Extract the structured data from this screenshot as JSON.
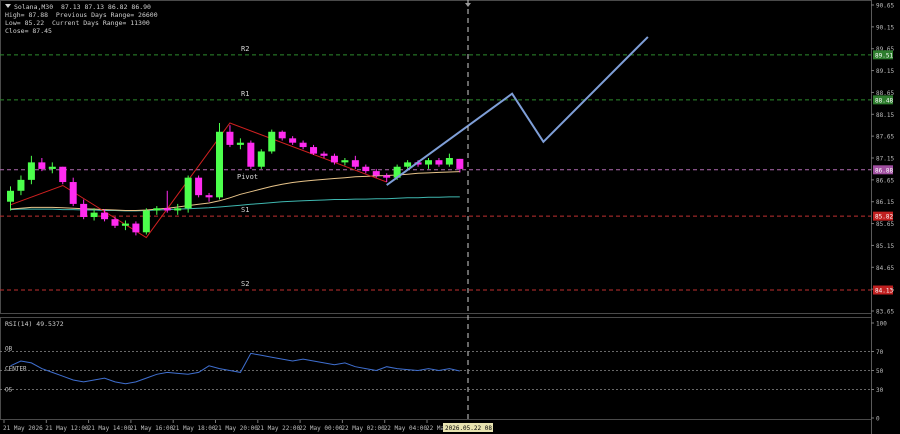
{
  "header": {
    "symbol_line": "Solana,M30  87.13 87.13 86.82 86.90",
    "lines": [
      "High= 87.88  Previous Days Range= 26600",
      "Low= 85.22  Current Days Range= 11300",
      "Close= 87.45"
    ]
  },
  "colors": {
    "bull": "#4cff4c",
    "bear": "#ff2bf0",
    "r_line": "#2e8b2e",
    "s_line": "#c03030",
    "pivot_line": "#b06ab0",
    "ma_fast": "#e8c48a",
    "ma_slow": "#3fb8b0",
    "forecast": "#7f9fd8",
    "zigzag": "#d02020",
    "rsi": "#3f6fd0",
    "r_tag": "#2e7d2e",
    "s_tag": "#c02020",
    "pivot_tag": "#a04fa0"
  },
  "chart_data": {
    "type": "candlestick",
    "price_axis": {
      "min": 83.65,
      "max": 90.65,
      "ticks": [
        "90.65",
        "90.15",
        "89.65",
        "89.15",
        "88.65",
        "88.15",
        "87.65",
        "87.15",
        "86.65",
        "86.15",
        "85.65",
        "85.15",
        "84.65",
        "84.15",
        "83.65"
      ]
    },
    "time_labels": [
      "21 May 2026",
      "21 May 12:00",
      "21 May 14:00",
      "21 May 16:00",
      "21 May 18:00",
      "21 May 20:00",
      "21 May 22:00",
      "22 May 00:00",
      "22 May 02:00",
      "22 May 04:00",
      "22 May 06:00"
    ],
    "cursor_time": "2026.05.22 08:00",
    "levels": [
      {
        "name": "R2",
        "value": 89.51,
        "tag": "89.51",
        "kind": "r"
      },
      {
        "name": "R1",
        "value": 88.48,
        "tag": "88.48",
        "kind": "r"
      },
      {
        "name": "Pivot",
        "value": 86.88,
        "tag": "86.88",
        "kind": "p"
      },
      {
        "name": "S1",
        "value": 85.82,
        "tag": "85.82",
        "kind": "s"
      },
      {
        "name": "S2",
        "value": 84.13,
        "tag": "84.13",
        "kind": "s"
      }
    ],
    "candles": [
      {
        "o": 86.15,
        "h": 86.5,
        "l": 85.95,
        "c": 86.4
      },
      {
        "o": 86.4,
        "h": 86.75,
        "l": 86.3,
        "c": 86.65
      },
      {
        "o": 86.65,
        "h": 87.2,
        "l": 86.55,
        "c": 87.05
      },
      {
        "o": 87.05,
        "h": 87.15,
        "l": 86.85,
        "c": 86.9
      },
      {
        "o": 86.9,
        "h": 87.05,
        "l": 86.8,
        "c": 86.95
      },
      {
        "o": 86.95,
        "h": 86.95,
        "l": 86.55,
        "c": 86.6
      },
      {
        "o": 86.6,
        "h": 86.7,
        "l": 86.05,
        "c": 86.1
      },
      {
        "o": 86.1,
        "h": 86.2,
        "l": 85.75,
        "c": 85.8
      },
      {
        "o": 85.8,
        "h": 86.0,
        "l": 85.72,
        "c": 85.9
      },
      {
        "o": 85.9,
        "h": 85.98,
        "l": 85.7,
        "c": 85.75
      },
      {
        "o": 85.75,
        "h": 85.8,
        "l": 85.55,
        "c": 85.6
      },
      {
        "o": 85.6,
        "h": 85.72,
        "l": 85.5,
        "c": 85.65
      },
      {
        "o": 85.65,
        "h": 85.7,
        "l": 85.38,
        "c": 85.45
      },
      {
        "o": 85.45,
        "h": 86.0,
        "l": 85.4,
        "c": 85.95
      },
      {
        "o": 85.95,
        "h": 86.05,
        "l": 85.85,
        "c": 86.0
      },
      {
        "o": 86.0,
        "h": 86.4,
        "l": 85.9,
        "c": 85.95
      },
      {
        "o": 85.95,
        "h": 86.1,
        "l": 85.85,
        "c": 86.0
      },
      {
        "o": 86.0,
        "h": 86.75,
        "l": 85.9,
        "c": 86.7
      },
      {
        "o": 86.7,
        "h": 86.75,
        "l": 86.25,
        "c": 86.3
      },
      {
        "o": 86.3,
        "h": 86.35,
        "l": 86.15,
        "c": 86.25
      },
      {
        "o": 86.25,
        "h": 87.95,
        "l": 86.2,
        "c": 87.75
      },
      {
        "o": 87.75,
        "h": 87.9,
        "l": 87.4,
        "c": 87.45
      },
      {
        "o": 87.45,
        "h": 87.6,
        "l": 87.35,
        "c": 87.5
      },
      {
        "o": 87.5,
        "h": 87.55,
        "l": 86.9,
        "c": 86.95
      },
      {
        "o": 86.95,
        "h": 87.35,
        "l": 86.9,
        "c": 87.3
      },
      {
        "o": 87.3,
        "h": 87.8,
        "l": 87.25,
        "c": 87.75
      },
      {
        "o": 87.75,
        "h": 87.78,
        "l": 87.55,
        "c": 87.6
      },
      {
        "o": 87.6,
        "h": 87.65,
        "l": 87.45,
        "c": 87.5
      },
      {
        "o": 87.5,
        "h": 87.55,
        "l": 87.35,
        "c": 87.4
      },
      {
        "o": 87.4,
        "h": 87.45,
        "l": 87.22,
        "c": 87.25
      },
      {
        "o": 87.25,
        "h": 87.3,
        "l": 87.15,
        "c": 87.2
      },
      {
        "o": 87.2,
        "h": 87.25,
        "l": 87.0,
        "c": 87.05
      },
      {
        "o": 87.05,
        "h": 87.15,
        "l": 86.98,
        "c": 87.1
      },
      {
        "o": 87.1,
        "h": 87.2,
        "l": 86.9,
        "c": 86.95
      },
      {
        "o": 86.95,
        "h": 87.0,
        "l": 86.8,
        "c": 86.85
      },
      {
        "o": 86.85,
        "h": 86.9,
        "l": 86.7,
        "c": 86.75
      },
      {
        "o": 86.75,
        "h": 86.8,
        "l": 86.6,
        "c": 86.7
      },
      {
        "o": 86.7,
        "h": 87.0,
        "l": 86.65,
        "c": 86.95
      },
      {
        "o": 86.95,
        "h": 87.1,
        "l": 86.9,
        "c": 87.05
      },
      {
        "o": 87.05,
        "h": 87.1,
        "l": 86.95,
        "c": 87.0
      },
      {
        "o": 87.0,
        "h": 87.15,
        "l": 86.9,
        "c": 87.1
      },
      {
        "o": 87.1,
        "h": 87.15,
        "l": 86.95,
        "c": 87.0
      },
      {
        "o": 87.0,
        "h": 87.25,
        "l": 86.95,
        "c": 87.15
      },
      {
        "o": 87.13,
        "h": 87.13,
        "l": 86.82,
        "c": 86.9
      }
    ],
    "ma_fast": [
      85.98,
      86.0,
      86.02,
      86.02,
      86.02,
      86.01,
      86.0,
      85.99,
      85.98,
      85.97,
      85.96,
      85.95,
      85.95,
      85.96,
      85.98,
      86.0,
      86.03,
      86.06,
      86.09,
      86.12,
      86.17,
      86.24,
      86.32,
      86.38,
      86.44,
      86.5,
      86.55,
      86.59,
      86.62,
      86.64,
      86.66,
      86.68,
      86.7,
      86.72,
      86.73,
      86.74,
      86.75,
      86.76,
      86.78,
      86.8,
      86.81,
      86.82,
      86.83,
      86.84
    ],
    "ma_slow": [
      85.97,
      85.98,
      85.98,
      85.98,
      85.98,
      85.97,
      85.97,
      85.96,
      85.96,
      85.95,
      85.95,
      85.94,
      85.94,
      85.95,
      85.96,
      85.97,
      85.98,
      85.99,
      86.0,
      86.01,
      86.03,
      86.05,
      86.07,
      86.09,
      86.11,
      86.13,
      86.15,
      86.16,
      86.17,
      86.18,
      86.19,
      86.2,
      86.2,
      86.21,
      86.21,
      86.22,
      86.22,
      86.23,
      86.24,
      86.24,
      86.25,
      86.25,
      86.26,
      86.26
    ],
    "zigzag": [
      [
        0,
        86.08
      ],
      [
        5,
        86.52
      ],
      [
        13,
        85.33
      ],
      [
        21,
        87.95
      ],
      [
        36,
        86.6
      ]
    ],
    "forecast": [
      [
        36,
        86.53
      ],
      [
        48,
        88.62
      ],
      [
        51,
        87.52
      ],
      [
        61,
        89.92
      ]
    ],
    "rsi": {
      "label": "RSI(14) 49.5372",
      "axis_ticks": [
        "100",
        "70",
        "50",
        "30",
        "0"
      ],
      "levels": [
        {
          "name": "OB",
          "value": 70
        },
        {
          "name": "CENTER",
          "value": 50
        },
        {
          "name": "OS",
          "value": 30
        }
      ],
      "values": [
        55,
        60,
        58,
        52,
        48,
        44,
        40,
        38,
        40,
        42,
        38,
        36,
        38,
        42,
        46,
        48,
        47,
        46,
        48,
        55,
        52,
        50,
        48,
        68,
        66,
        64,
        62,
        60,
        62,
        60,
        58,
        56,
        58,
        54,
        52,
        50,
        54,
        52,
        51,
        50,
        52,
        50,
        52,
        49.5
      ]
    }
  }
}
